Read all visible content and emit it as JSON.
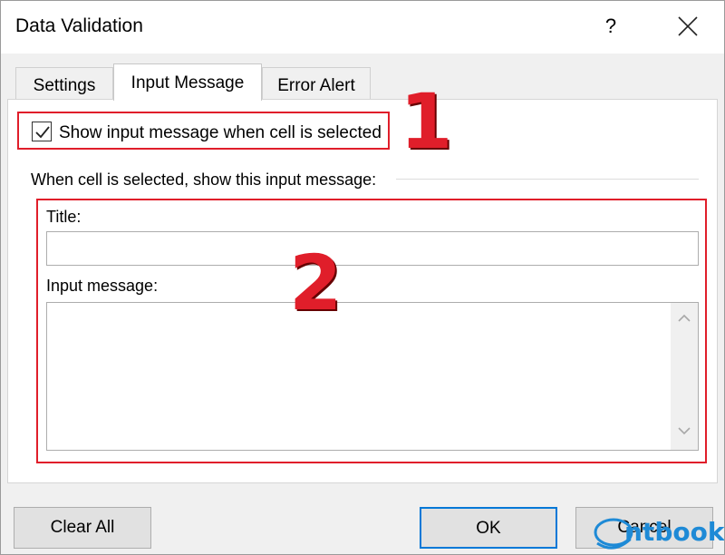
{
  "window": {
    "title": "Data Validation",
    "help_glyph": "?"
  },
  "tabs": [
    {
      "label": "Settings"
    },
    {
      "label": "Input Message"
    },
    {
      "label": "Error Alert"
    }
  ],
  "input_message": {
    "show_checkbox_label": "Show input message when cell is selected",
    "show_checkbox_checked": true,
    "group_label": "When cell is selected, show this input message:",
    "title_label": "Title:",
    "title_value": "",
    "message_label": "Input message:",
    "message_value": ""
  },
  "annotations": {
    "marker_1": "1",
    "marker_2": "2",
    "highlight_color": "#e01e2a"
  },
  "buttons": {
    "clear_all": "Clear All",
    "ok": "OK",
    "cancel": "Cancel"
  },
  "watermark": {
    "text": "ntbook"
  }
}
